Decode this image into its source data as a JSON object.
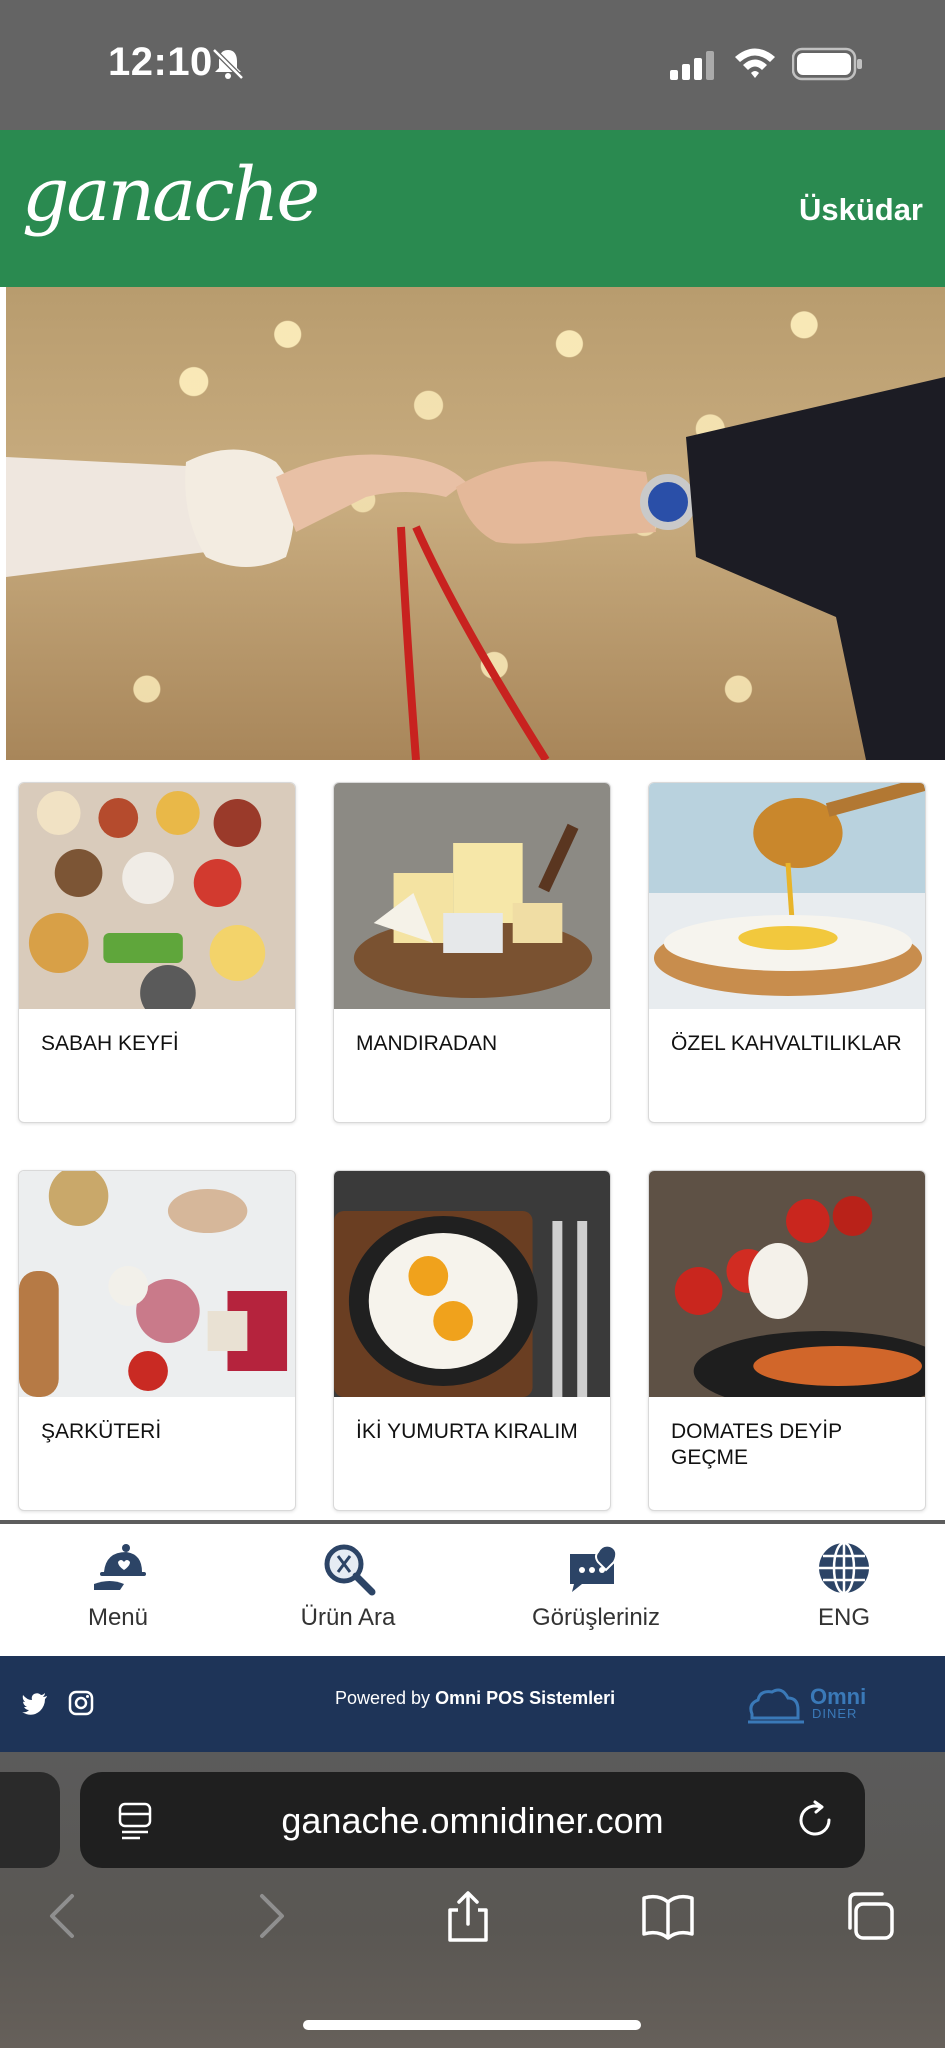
{
  "status_bar": {
    "time": "12:10"
  },
  "header": {
    "logo": "ganache",
    "location": "Üsküdar"
  },
  "categories": [
    {
      "label": "SABAH KEYFİ"
    },
    {
      "label": "MANDIRADAN"
    },
    {
      "label": "ÖZEL KAHVALTILIKLAR"
    },
    {
      "label": "ŞARKÜTERİ"
    },
    {
      "label": "İKİ YUMURTA KIRALIM"
    },
    {
      "label": "DOMATES DEYİP GEÇME"
    }
  ],
  "bottom_nav": [
    {
      "label": "Menü",
      "icon": "cloche-icon"
    },
    {
      "label": "Ürün Ara",
      "icon": "search-icon"
    },
    {
      "label": "Görüşleriniz",
      "icon": "feedback-heart-icon"
    },
    {
      "label": "ENG",
      "icon": "globe-icon"
    }
  ],
  "footer": {
    "powered_prefix": "Powered by",
    "powered_brand": "Omni POS Sistemleri",
    "omni_logo": "Omni",
    "omni_logo_sub": "DINER"
  },
  "browser": {
    "url": "ganache.omnidiner.com"
  },
  "colors": {
    "header": "#2a8a50",
    "footer": "#1e3458",
    "nav_icon": "#2c4466"
  }
}
